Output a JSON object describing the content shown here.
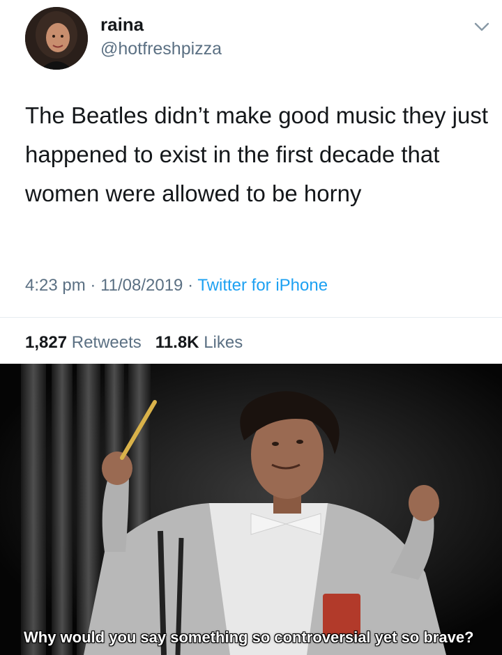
{
  "tweet": {
    "name": "raina",
    "handle": "@hotfreshpizza",
    "text": "The Beatles didn’t make good music they just happened to exist in the first decade that women were allowed to be horny",
    "time": "4:23 pm",
    "date": "11/08/2019",
    "source": "Twitter for iPhone",
    "retweets_count": "1,827",
    "retweets_label": "Retweets",
    "likes_count": "11.8K",
    "likes_label": "Likes",
    "menu_icon": "chevron-down-icon"
  },
  "meme": {
    "caption": "Why would you say something so controversial yet so brave?"
  }
}
